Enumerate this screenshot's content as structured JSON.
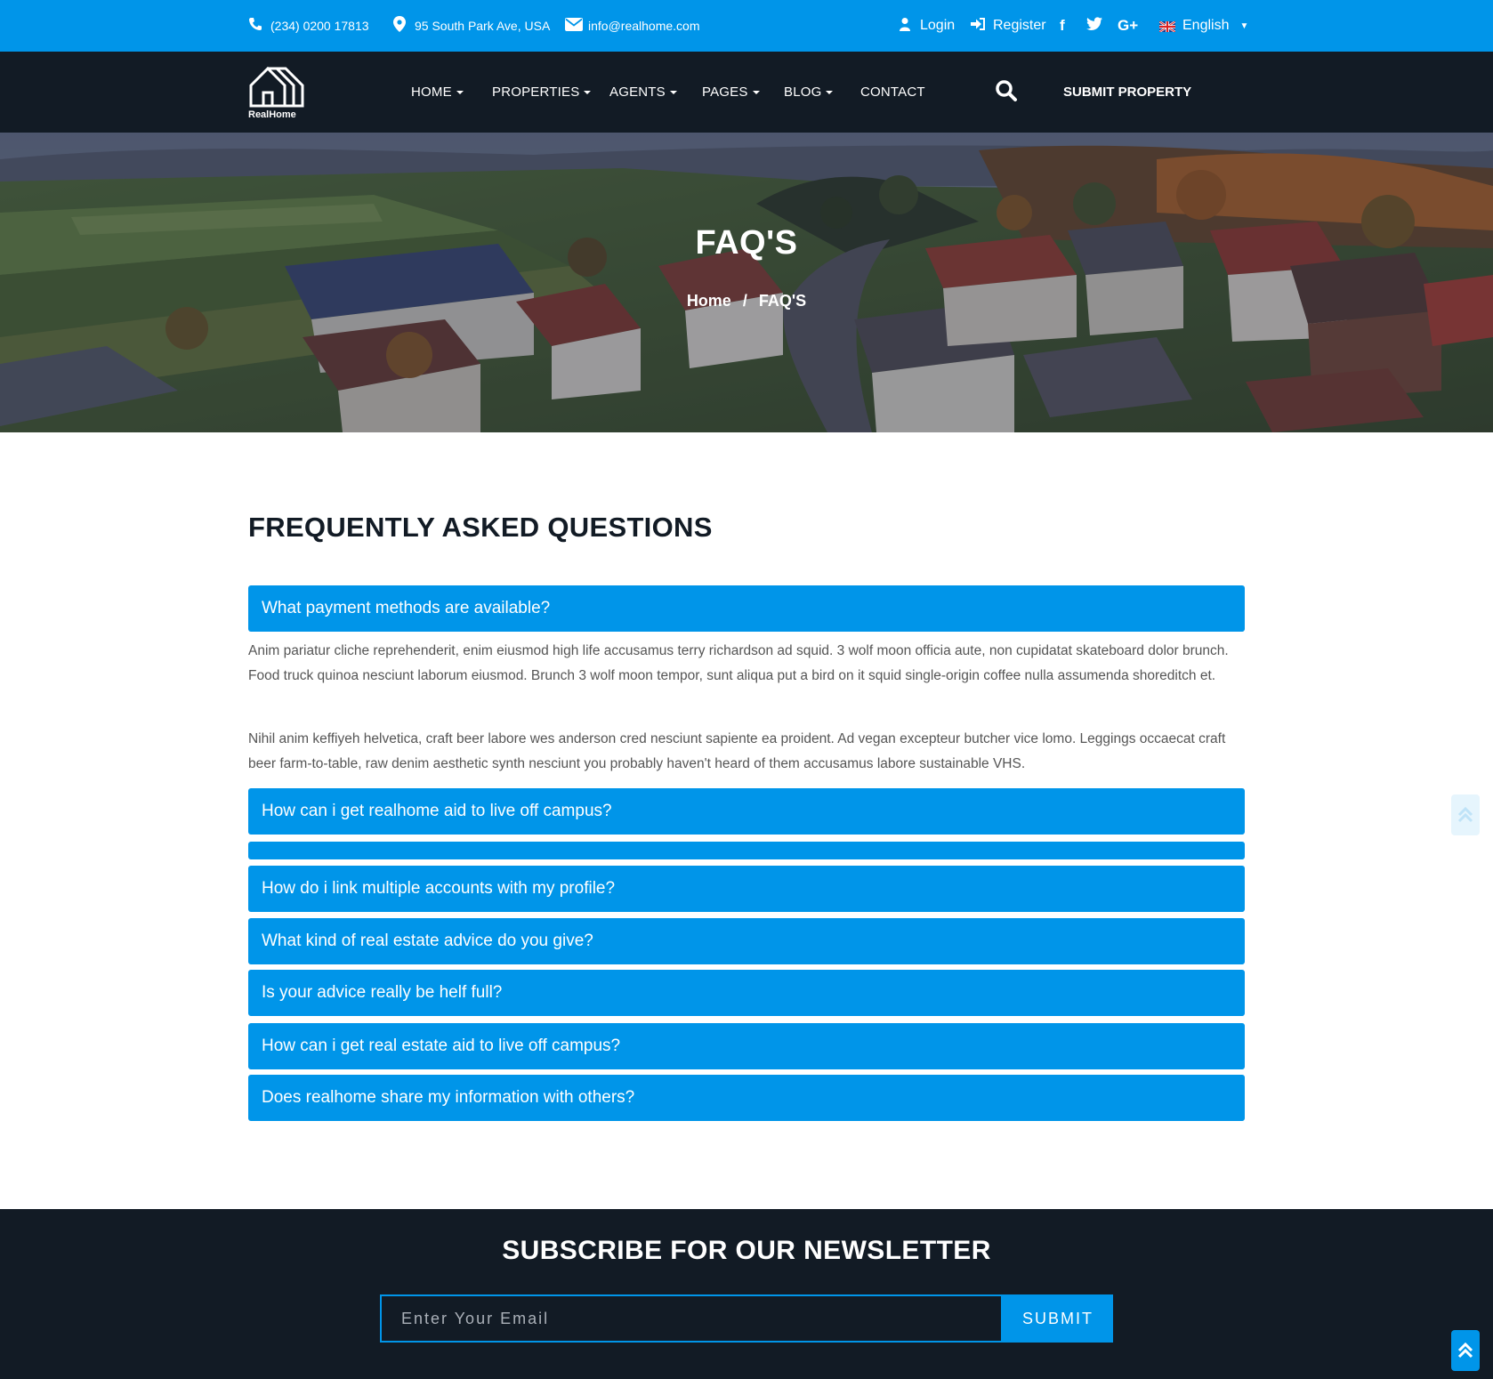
{
  "topbar": {
    "phone": "(234) 0200 17813",
    "address": "95 South Park Ave, USA",
    "email": "info@realhome.com",
    "login": "Login",
    "register": "Register",
    "social": [
      "f",
      "t",
      "G+"
    ],
    "language": "English"
  },
  "brand": {
    "name": "RealHome"
  },
  "nav": {
    "items": [
      "HOME",
      "PROPERTIES",
      "AGENTS",
      "PAGES",
      "BLOG",
      "CONTACT"
    ],
    "submit": "SUBMIT PROPERTY"
  },
  "hero": {
    "title": "FAQ'S",
    "breadcrumb_home": "Home",
    "breadcrumb_sep": "/",
    "breadcrumb_current": "FAQ'S"
  },
  "faq": {
    "heading": "FREQUENTLY ASKED QUESTIONS",
    "questions": [
      "What payment methods are available?",
      "How can i get realhome aid to live off campus?",
      "",
      "How do i link multiple accounts with my profile?",
      "What kind of real estate advice do you give?",
      "Is your advice really be helf full?",
      "How can i get real estate aid to live off campus?",
      "Does realhome share my information with others?"
    ],
    "answer_p1": "Anim pariatur cliche reprehenderit, enim eiusmod high life accusamus terry richardson ad squid. 3 wolf moon officia aute, non cupidatat skateboard dolor brunch. Food truck quinoa nesciunt laborum eiusmod. Brunch 3 wolf moon tempor, sunt aliqua put a bird on it squid single-origin coffee nulla assumenda shoreditch et.",
    "answer_p2": "Nihil anim keffiyeh helvetica, craft beer labore wes anderson cred nesciunt sapiente ea proident. Ad vegan excepteur butcher vice lomo. Leggings occaecat craft beer farm-to-table, raw denim aesthetic synth nesciunt you probably haven't heard of them accusamus labore sustainable VHS."
  },
  "newsletter": {
    "title": "SUBSCRIBE FOR OUR NEWSLETTER",
    "placeholder": "Enter Your Email",
    "submit": "SUBMIT"
  },
  "colors": {
    "primary": "#0095e9",
    "dark": "#121b25"
  },
  "icons": [
    "phone-icon",
    "map-marker-icon",
    "envelope-icon",
    "user-icon",
    "sign-in-icon",
    "facebook-icon",
    "twitter-icon",
    "google-plus-icon",
    "uk-flag-icon",
    "search-icon",
    "chevron-double-up-icon"
  ]
}
